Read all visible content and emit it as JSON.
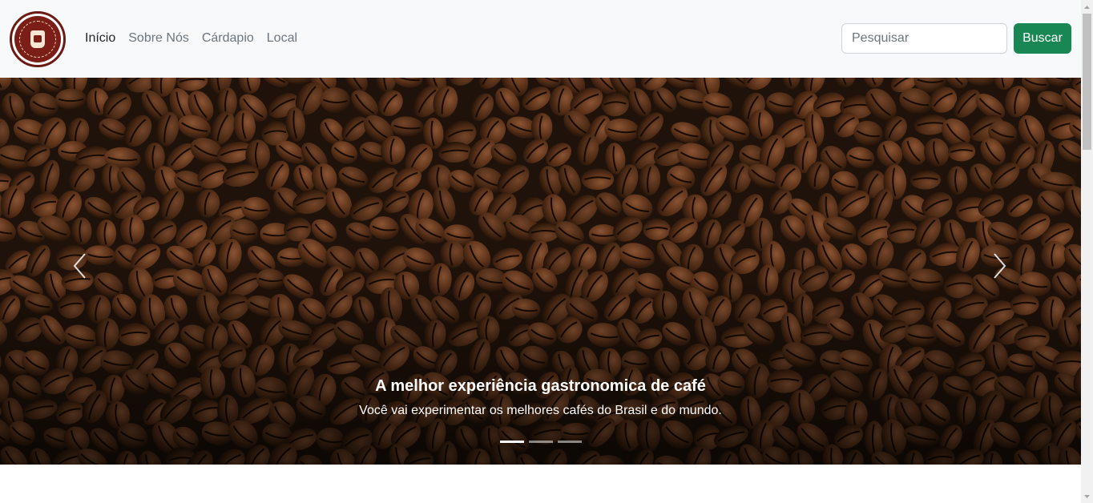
{
  "nav": {
    "links": [
      {
        "label": "Início",
        "active": true
      },
      {
        "label": "Sobre Nós",
        "active": false
      },
      {
        "label": "Cárdapio",
        "active": false
      },
      {
        "label": "Local",
        "active": false
      }
    ]
  },
  "search": {
    "placeholder": "Pesquisar",
    "value": "",
    "button_label": "Buscar"
  },
  "carousel": {
    "title": "A melhor experiência gastronomica de café",
    "text": "Você vai experimentar os melhores cafés do Brasil e do mundo.",
    "slide_count": 3,
    "active_index": 0
  },
  "icons": {
    "prev": "chevron-left-icon",
    "next": "chevron-right-icon",
    "logo": "coffee-cup-logo"
  },
  "colors": {
    "navbar_bg": "#f8f9fa",
    "button_green": "#198754",
    "logo_brown": "#7a1e17",
    "active_link": "#212529",
    "muted_link": "#6c757d"
  }
}
